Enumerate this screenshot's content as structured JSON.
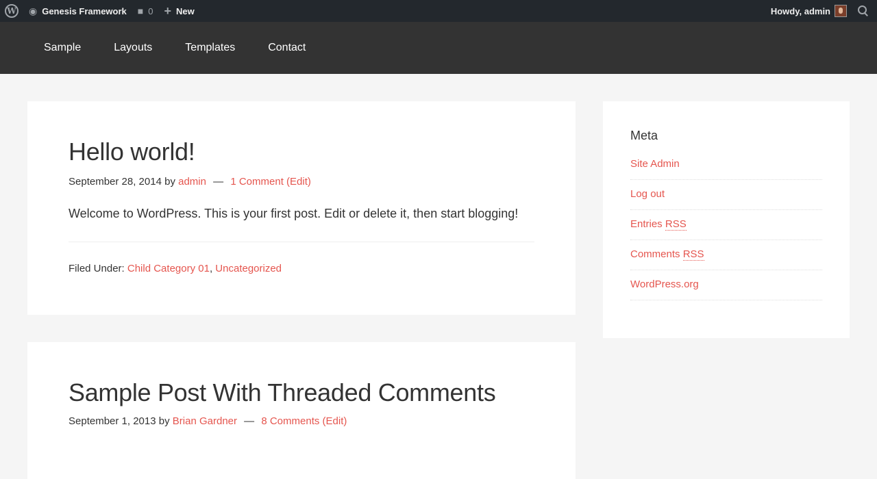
{
  "adminbar": {
    "wp_logo": "W",
    "site_name": "Genesis Framework",
    "comments_count": "0",
    "new_label": "New",
    "howdy": "Howdy, admin"
  },
  "nav": {
    "items": [
      "Sample",
      "Layouts",
      "Templates",
      "Contact"
    ]
  },
  "posts": [
    {
      "title": "Hello world!",
      "date": "September 28, 2014",
      "by": "by",
      "author": "admin",
      "comments": "1 Comment",
      "edit": "(Edit)",
      "content": "Welcome to WordPress. This is your first post. Edit or delete it, then start blogging!",
      "filed_under": "Filed Under:",
      "categories": [
        "Child Category 01",
        "Uncategorized"
      ]
    },
    {
      "title": "Sample Post With Threaded Comments",
      "date": "September 1, 2013",
      "by": "by",
      "author": "Brian Gardner",
      "comments": "8 Comments",
      "edit": "(Edit)"
    }
  ],
  "sidebar": {
    "title": "Meta",
    "items": [
      {
        "label": "Site Admin"
      },
      {
        "label": "Log out"
      },
      {
        "label": "Entries",
        "abbr": "RSS"
      },
      {
        "label": "Comments",
        "abbr": "RSS"
      },
      {
        "label": "WordPress.org"
      }
    ]
  },
  "colors": {
    "accent": "#e5554e",
    "adminbar": "#23282d",
    "header": "#333333",
    "background": "#f5f5f5"
  }
}
